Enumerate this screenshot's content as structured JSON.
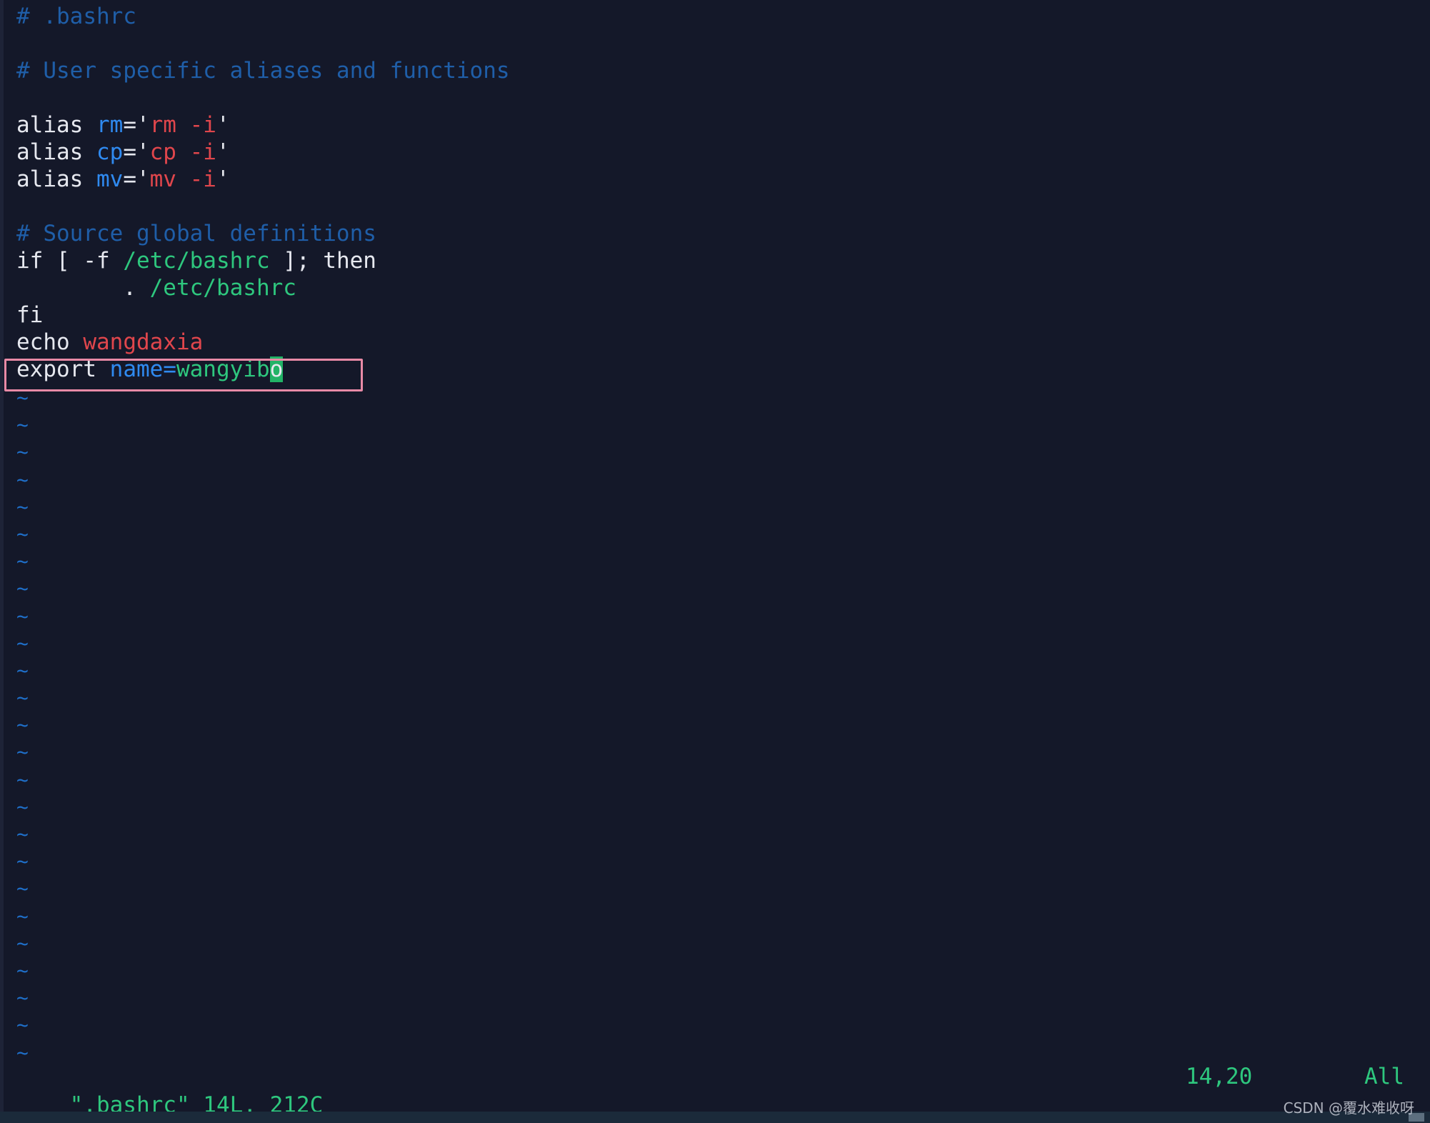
{
  "editor": {
    "tilde_char": "~",
    "tilde_count": 25,
    "lines": [
      {
        "id": "comment-bashrc",
        "spans": [
          {
            "text": "# .bashrc",
            "color": "#1f5ea8"
          }
        ]
      },
      {
        "id": "blank-1",
        "spans": []
      },
      {
        "id": "comment-aliases",
        "spans": [
          {
            "text": "# User specific aliases and functions",
            "color": "#1f5ea8"
          }
        ]
      },
      {
        "id": "blank-2",
        "spans": []
      },
      {
        "id": "alias-rm",
        "spans": [
          {
            "text": "alias ",
            "color": "#e6e8ef"
          },
          {
            "text": "rm",
            "color": "#2f8af0"
          },
          {
            "text": "='",
            "color": "#e6e8ef"
          },
          {
            "text": "rm -i",
            "color": "#e0464c"
          },
          {
            "text": "'",
            "color": "#e6e8ef"
          }
        ]
      },
      {
        "id": "alias-cp",
        "spans": [
          {
            "text": "alias ",
            "color": "#e6e8ef"
          },
          {
            "text": "cp",
            "color": "#2f8af0"
          },
          {
            "text": "='",
            "color": "#e6e8ef"
          },
          {
            "text": "cp -i",
            "color": "#e0464c"
          },
          {
            "text": "'",
            "color": "#e6e8ef"
          }
        ]
      },
      {
        "id": "alias-mv",
        "spans": [
          {
            "text": "alias ",
            "color": "#e6e8ef"
          },
          {
            "text": "mv",
            "color": "#2f8af0"
          },
          {
            "text": "='",
            "color": "#e6e8ef"
          },
          {
            "text": "mv -i",
            "color": "#e0464c"
          },
          {
            "text": "'",
            "color": "#e6e8ef"
          }
        ]
      },
      {
        "id": "blank-3",
        "spans": []
      },
      {
        "id": "comment-source",
        "spans": [
          {
            "text": "# Source global definitions",
            "color": "#1f5ea8"
          }
        ]
      },
      {
        "id": "if-line",
        "spans": [
          {
            "text": "if [ -f ",
            "color": "#e6e8ef"
          },
          {
            "text": "/etc/bashrc",
            "color": "#2ec77e"
          },
          {
            "text": " ]; then",
            "color": "#e6e8ef"
          }
        ]
      },
      {
        "id": "source-line",
        "spans": [
          {
            "text": "        . ",
            "color": "#e6e8ef"
          },
          {
            "text": "/etc/bashrc",
            "color": "#2ec77e"
          }
        ]
      },
      {
        "id": "fi-line",
        "spans": [
          {
            "text": "fi",
            "color": "#e6e8ef"
          }
        ]
      },
      {
        "id": "echo-line",
        "spans": [
          {
            "text": "echo ",
            "color": "#e6e8ef"
          },
          {
            "text": "wangdaxia",
            "color": "#e0464c"
          }
        ]
      },
      {
        "id": "export-line",
        "spans": [
          {
            "text": "export ",
            "color": "#e6e8ef"
          },
          {
            "text": "name=",
            "color": "#2f8af0"
          },
          {
            "text": "wangyib",
            "color": "#2ec77e"
          },
          {
            "text": "o",
            "color": "#e6e8ef",
            "cursor": true
          }
        ]
      }
    ]
  },
  "status": {
    "file_info": "\".bashrc\" 14L, 212C",
    "cursor_pos": "14,20",
    "scroll": "All"
  },
  "watermark": "CSDN @覆水难收呀",
  "colors": {
    "background": "#141829",
    "comment": "#1f5ea8",
    "keyword": "#2f8af0",
    "string": "#e0464c",
    "path": "#2ec77e",
    "status": "#2ec77e",
    "cursor": "#22b366",
    "highlight_box": "#e88aa6"
  }
}
